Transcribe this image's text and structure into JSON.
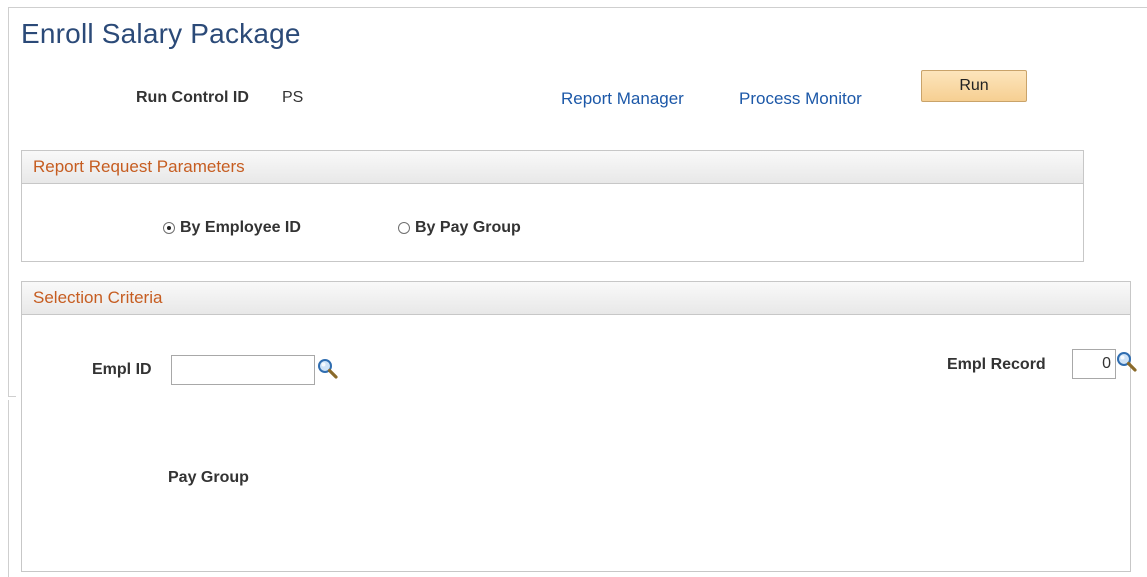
{
  "page": {
    "title": "Enroll Salary Package"
  },
  "run_control": {
    "label": "Run Control ID",
    "value": "PS"
  },
  "links": {
    "report_manager": "Report Manager",
    "process_monitor": "Process Monitor"
  },
  "buttons": {
    "run": "Run"
  },
  "report_request": {
    "header": "Report Request Parameters",
    "options": [
      {
        "label": "By Employee ID",
        "selected": true
      },
      {
        "label": "By Pay Group",
        "selected": false
      }
    ]
  },
  "selection_criteria": {
    "header": "Selection Criteria",
    "empl_id": {
      "label": "Empl ID",
      "value": ""
    },
    "empl_record": {
      "label": "Empl Record",
      "value": "0"
    },
    "pay_group": {
      "label": "Pay Group"
    }
  },
  "icons": {
    "lookup": "magnifying-glass-icon"
  },
  "colors": {
    "title": "#2b4a78",
    "link": "#1c58a8",
    "section_header": "#c65d21",
    "run_button": "#f6cf92"
  }
}
